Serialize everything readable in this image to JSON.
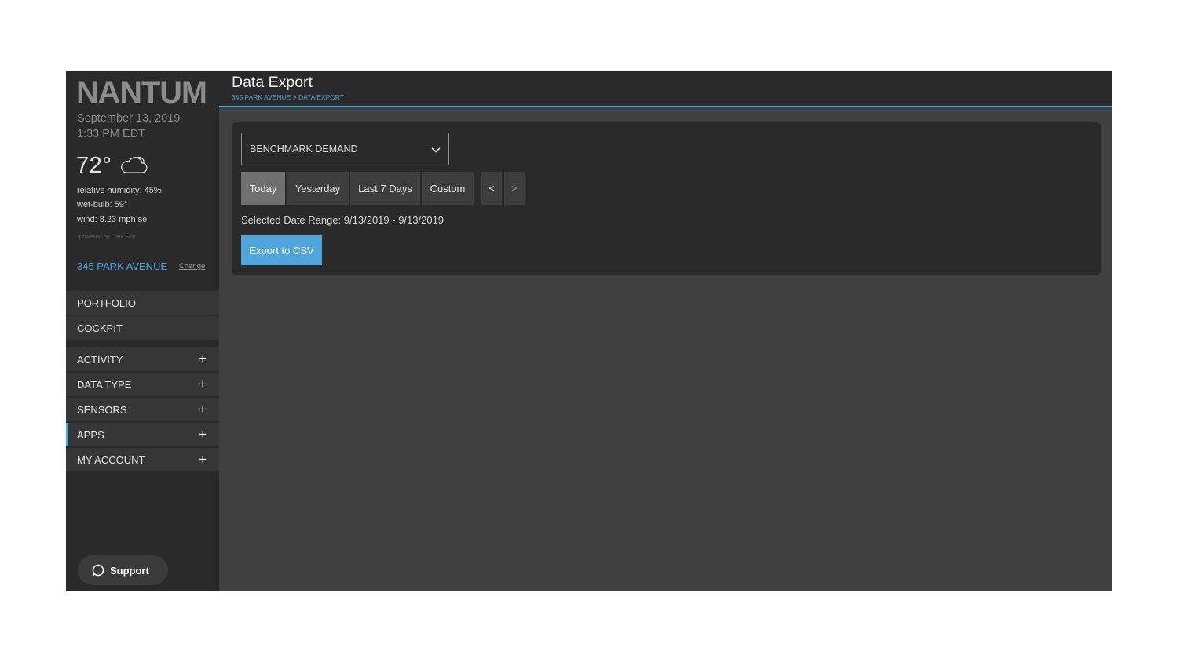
{
  "sidebar": {
    "logo_text": "NANTUM",
    "date": "September 13, 2019",
    "time": "1:33 PM EDT",
    "weather": {
      "temperature": "72°",
      "humidity": "relative humidity: 45%",
      "wet_bulb": "wet-bulb: 59°",
      "wind": "wind: 8.23 mph se",
      "powered_by": "*powered by Dark Sky",
      "icon": "cloud-icon"
    },
    "location": "345 PARK AVENUE",
    "change_label": "Change",
    "primary_nav": [
      {
        "label": "PORTFOLIO"
      },
      {
        "label": "COCKPIT"
      }
    ],
    "expandable_nav": [
      {
        "label": "ACTIVITY",
        "expand": "+"
      },
      {
        "label": "DATA TYPE",
        "expand": "+"
      },
      {
        "label": "SENSORS",
        "expand": "+"
      },
      {
        "label": "APPS",
        "expand": "+",
        "active": true
      },
      {
        "label": "MY ACCOUNT",
        "expand": "+"
      }
    ],
    "support_label": "Support"
  },
  "header": {
    "title": "Data Export",
    "breadcrumb": "345 PARK AVENUE > DATA EXPORT"
  },
  "panel": {
    "dataset_select": "BENCHMARK DEMAND",
    "range_buttons": [
      {
        "label": "Today",
        "active": true
      },
      {
        "label": "Yesterday"
      },
      {
        "label": "Last 7 Days"
      },
      {
        "label": "Custom"
      }
    ],
    "prev_label": "<",
    "next_label": ">",
    "selected_range": "Selected Date Range: 9/13/2019 - 9/13/2019",
    "export_label": "Export to CSV"
  },
  "colors": {
    "accent": "#4aa8e0",
    "sidebar_bg": "#2a2a2a",
    "content_bg": "#404040",
    "export_button": "#4fa6dd"
  }
}
